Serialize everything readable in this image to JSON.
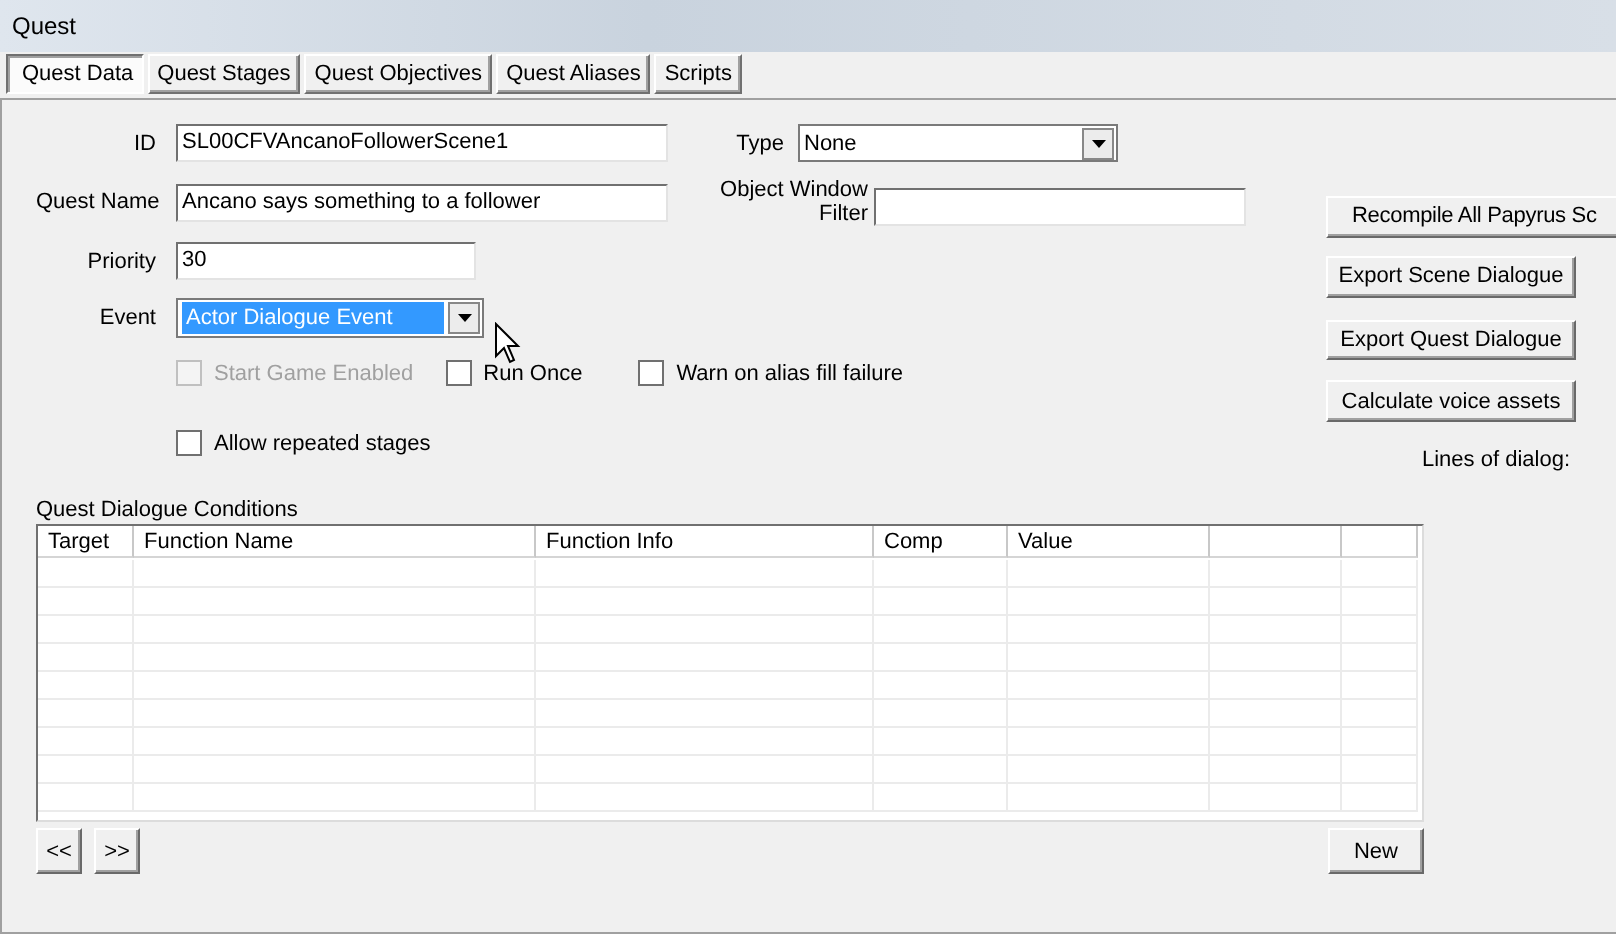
{
  "window": {
    "title": "Quest"
  },
  "tabs": [
    {
      "label": "Quest Data",
      "selected": true
    },
    {
      "label": "Quest Stages",
      "selected": false
    },
    {
      "label": "Quest Objectives",
      "selected": false
    },
    {
      "label": "Quest Aliases",
      "selected": false
    },
    {
      "label": "Scripts",
      "selected": false
    }
  ],
  "form": {
    "id": {
      "label": "ID",
      "value": "SL00CFVAncanoFollowerScene1"
    },
    "type": {
      "label": "Type",
      "value": "None"
    },
    "quest_name": {
      "label": "Quest Name",
      "value": "Ancano says something to a follower"
    },
    "object_window_filter": {
      "label": "Object Window Filter"
    },
    "priority": {
      "label": "Priority",
      "value": "30"
    },
    "event": {
      "label": "Event",
      "value": "Actor Dialogue Event",
      "focused": true
    }
  },
  "checkboxes": [
    {
      "label": "Start Game Enabled",
      "checked": false,
      "disabled": true
    },
    {
      "label": "Run Once",
      "checked": false,
      "disabled": false
    },
    {
      "label": "Warn on alias fill failure",
      "checked": false,
      "disabled": false
    },
    {
      "label": "Allow repeated stages",
      "checked": false,
      "disabled": false
    }
  ],
  "side_buttons": [
    "Recompile All Papyrus Sc",
    "Export Scene Dialogue",
    "Export Quest Dialogue",
    "Calculate voice assets"
  ],
  "lines_of_dialog": "Lines of dialog:",
  "conditions": {
    "title": "Quest Dialogue Conditions",
    "columns": [
      "Target",
      "Function Name",
      "Function Info",
      "Comp",
      "Value"
    ]
  },
  "nav_buttons": [
    "<<",
    ">>"
  ],
  "new_button": "New"
}
